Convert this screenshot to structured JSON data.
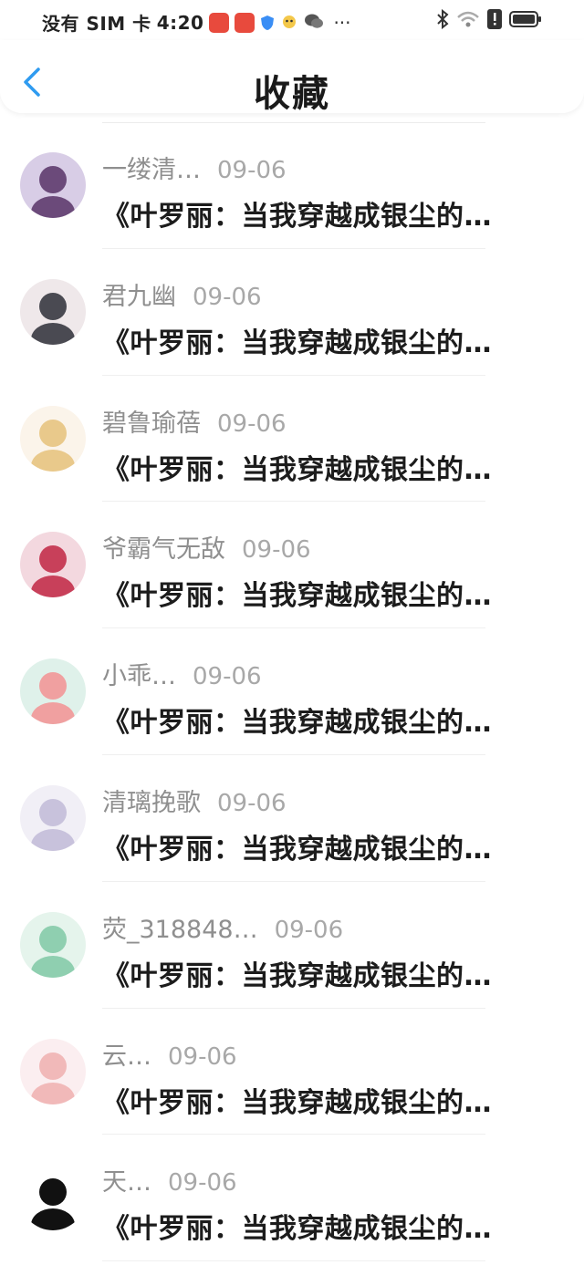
{
  "status_bar": {
    "carrier": "没有 SIM 卡",
    "time": "4:20",
    "more": "···"
  },
  "header": {
    "title": "收藏",
    "back_icon": "chevron-left-icon",
    "accent": "#2f9bf0"
  },
  "items": [
    {
      "name": "一缕清…",
      "date": "09-06",
      "content": "《叶罗丽：当我穿越成银尘的…",
      "avatar_color": "#6b4a7a",
      "avatar_bg": "#d8cde6"
    },
    {
      "name": "君九幽",
      "date": "09-06",
      "content": "《叶罗丽：当我穿越成银尘的…",
      "avatar_color": "#4a4a52",
      "avatar_bg": "#efe8ea"
    },
    {
      "name": "碧鲁瑜蓓",
      "date": "09-06",
      "content": "《叶罗丽：当我穿越成银尘的…",
      "avatar_color": "#e9c98b",
      "avatar_bg": "#fbf4ea"
    },
    {
      "name": "爷霸气无敌",
      "date": "09-06",
      "content": "《叶罗丽：当我穿越成银尘的…",
      "avatar_color": "#c8405a",
      "avatar_bg": "#f3d8df"
    },
    {
      "name": "小乖…",
      "date": "09-06",
      "content": "《叶罗丽：当我穿越成银尘的…",
      "avatar_color": "#f0a0a0",
      "avatar_bg": "#dff1ea"
    },
    {
      "name": "清璃挽歌",
      "date": "09-06",
      "content": "《叶罗丽：当我穿越成银尘的…",
      "avatar_color": "#c8c2dc",
      "avatar_bg": "#f1eff6"
    },
    {
      "name": "荧_318848…",
      "date": "09-06",
      "content": "《叶罗丽：当我穿越成银尘的…",
      "avatar_color": "#8fcfb0",
      "avatar_bg": "#e5f4ec"
    },
    {
      "name": "云…",
      "date": "09-06",
      "content": "《叶罗丽：当我穿越成银尘的…",
      "avatar_color": "#f1b9b9",
      "avatar_bg": "#fbeef0"
    },
    {
      "name": "天…",
      "date": "09-06",
      "content": "《叶罗丽：当我穿越成银尘的…",
      "avatar_color": "#111111",
      "avatar_bg": "#ffffff"
    }
  ]
}
